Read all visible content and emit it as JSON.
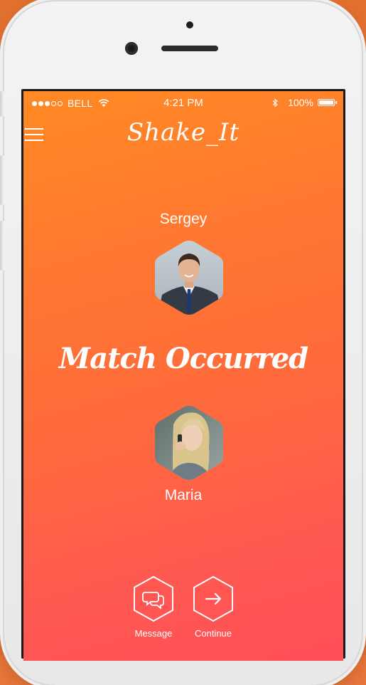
{
  "status_bar": {
    "carrier": "BELL",
    "time": "4:21 PM",
    "battery": "100%"
  },
  "app": {
    "logo": "Shake_It"
  },
  "match": {
    "top_name": "Sergey",
    "title": "Match Occurred",
    "bottom_name": "Maria"
  },
  "actions": {
    "message_label": "Message",
    "continue_label": "Continue"
  },
  "colors": {
    "gradient_top": "#ff8a24",
    "gradient_bottom": "#ff4f5a",
    "text": "#ffffff"
  },
  "icons": {
    "menu": "hamburger-menu-icon",
    "message": "chat-bubbles-icon",
    "continue": "arrow-right-icon",
    "wifi": "wifi-icon",
    "bluetooth": "bluetooth-icon",
    "battery": "battery-icon"
  }
}
